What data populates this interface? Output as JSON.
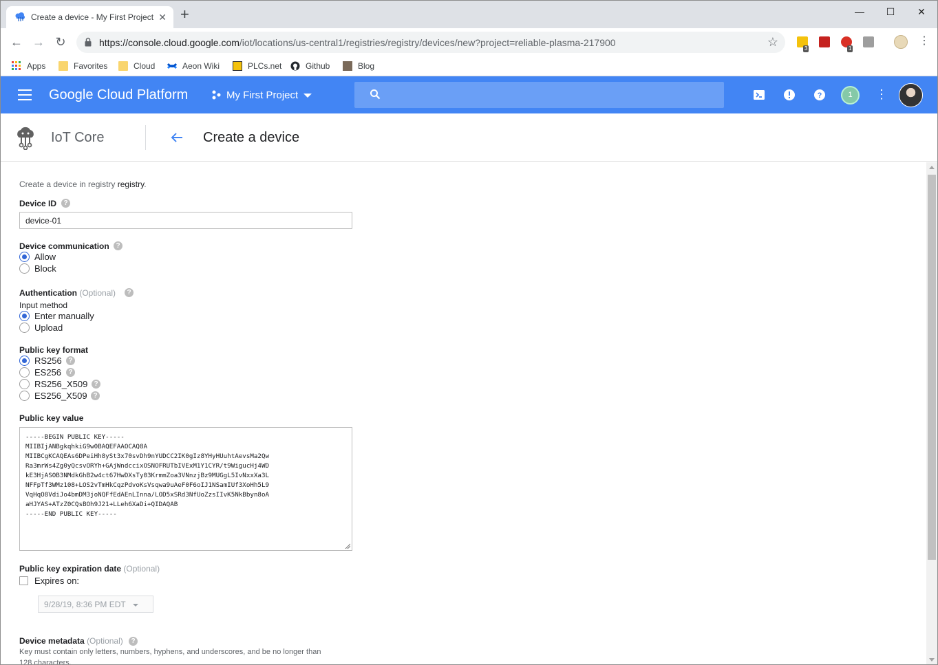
{
  "browser": {
    "tab_title": "Create a device - My First Project",
    "url_host": "https://console.cloud.google.com",
    "url_path": "/iot/locations/us-central1/registries/registry/devices/new?project=reliable-plasma-217900",
    "extensions": [
      {
        "name": "ext-yellow",
        "color": "#f4c20d",
        "badge": "3"
      },
      {
        "name": "ext-pdf",
        "color": "#c5221f",
        "badge": ""
      },
      {
        "name": "ext-abp",
        "color": "#d93025",
        "badge": "1"
      },
      {
        "name": "ext-g",
        "color": "#9e9e9e",
        "badge": ""
      }
    ],
    "bookmarks": [
      {
        "label": "Apps",
        "icon": "apps-grid-icon"
      },
      {
        "label": "Favorites",
        "icon": "folder-icon"
      },
      {
        "label": "Cloud",
        "icon": "folder-icon"
      },
      {
        "label": "Aeon Wiki",
        "icon": "confluence-icon"
      },
      {
        "label": "PLCs.net",
        "icon": "plcs-icon"
      },
      {
        "label": "Github",
        "icon": "github-icon"
      },
      {
        "label": "Blog",
        "icon": "blog-icon"
      }
    ]
  },
  "gcp": {
    "brand": "Google Cloud Platform",
    "project": "My First Project",
    "notification_count": "1",
    "accent": "#4285f4"
  },
  "page": {
    "product": "IoT Core",
    "title": "Create a device"
  },
  "form": {
    "intro_prefix": "Create a device in registry ",
    "intro_registry": "registry",
    "intro_suffix": ".",
    "device_id_label": "Device ID",
    "device_id_value": "device-01",
    "communication_label": "Device communication",
    "communication_options": [
      "Allow",
      "Block"
    ],
    "communication_selected": "Allow",
    "auth_label": "Authentication",
    "optional": "(Optional)",
    "input_method_label": "Input method",
    "input_method_options": [
      "Enter manually",
      "Upload"
    ],
    "input_method_selected": "Enter manually",
    "key_format_label": "Public key format",
    "key_format_options": [
      "RS256",
      "ES256",
      "RS256_X509",
      "ES256_X509"
    ],
    "key_format_selected": "RS256",
    "key_value_label": "Public key value",
    "key_value": "-----BEGIN PUBLIC KEY-----\nMIIBIjANBgkqhkiG9w0BAQEFAAOCAQ8A\nMIIBCgKCAQEAs6DPeiHh8ySt3x70svDh9nYUDCC2IK0gIz8YHyHUuhtAevsMa2Qw\nRa3mrWs4Zg0yQcsvORYh+GAjWndccixOSNOFRUTbIVExM1Y1CYR/t9WigucHj4WD\nkE3HjASOB3NMdkGhB2w4ct67HwDXsTy03KrmmZoa3VNnzjBz9MUGgL5IvNxxXa3L\nNFFpTf3WMz108+LOS2vTmHkCqzPdvoKsVsqwa9uAeF0F6oIJ1NSamIUf3XoHh5L9\nVqHqO8VdiJo4bmDM3joNQFfEdAEnLInna/LOD5xSRd3NfUoZzsIIvK5NkBbyn8oA\naHJYAS+ATzZ0CQsBOh9J21+LLeh6XaDi+QIDAQAB\n-----END PUBLIC KEY-----",
    "expiration_label": "Public key expiration date",
    "expires_on_label": "Expires on:",
    "expires_date": "9/28/19, 8:36 PM EDT",
    "metadata_label": "Device metadata",
    "metadata_hint_1": "Key must contain only letters, numbers, hyphens, and underscores, and be no longer than",
    "metadata_hint_2": "128 characters."
  }
}
